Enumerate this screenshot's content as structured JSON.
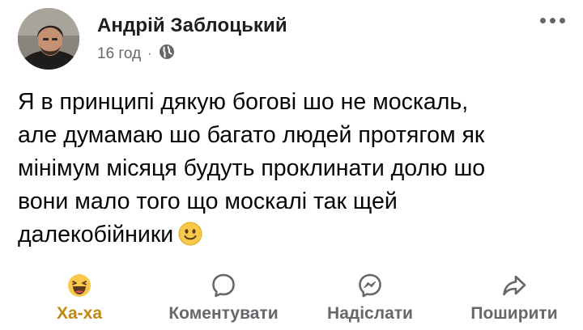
{
  "post": {
    "author": "Андрій Заблоцький",
    "time": "16 год",
    "separator": "·",
    "privacy_icon": "globe-icon",
    "text": "Я в принципі дякую богові шо не москаль,\nале думамаю шо багато людей протягом як\nмінімум місяця будуть проклинати долю шо\nвони мало того що москалі так щей\nдалекобійники",
    "emoji": "slightly-smiling-face"
  },
  "actions": {
    "reaction_label": "Ха-ха",
    "reaction_icon": "haha-icon",
    "comment_label": "Коментувати",
    "send_label": "Надіслати",
    "share_label": "Поширити"
  },
  "colors": {
    "reaction_active": "#c18a0c",
    "secondary_text": "#65676b",
    "primary_text": "#050505"
  }
}
